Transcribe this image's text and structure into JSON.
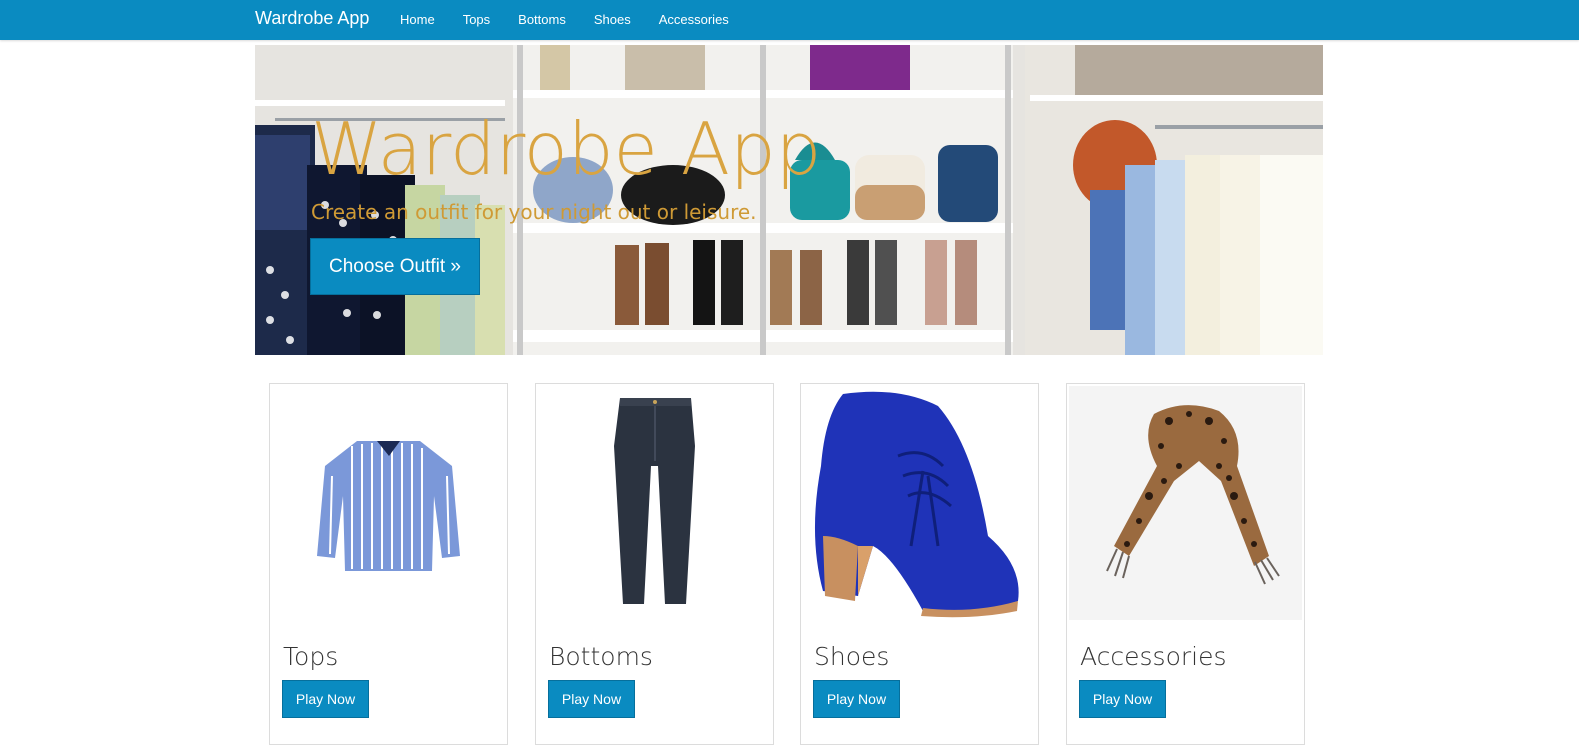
{
  "nav": {
    "brand": "Wardrobe App",
    "links": [
      "Home",
      "Tops",
      "Bottoms",
      "Shoes",
      "Accessories"
    ]
  },
  "hero": {
    "title": "Wardrobe App",
    "subtitle": "Create an outfit for your night out or leisure.",
    "button_label": "Choose Outfit »"
  },
  "cards": [
    {
      "title": "Tops",
      "button_label": "Play Now",
      "image": "striped-blouse"
    },
    {
      "title": "Bottoms",
      "button_label": "Play Now",
      "image": "dark-jeans"
    },
    {
      "title": "Shoes",
      "button_label": "Play Now",
      "image": "blue-ankle-boot"
    },
    {
      "title": "Accessories",
      "button_label": "Play Now",
      "image": "leopard-scarf"
    }
  ],
  "colors": {
    "primary": "#0a8bc1",
    "hero_text": "#d9a441"
  }
}
